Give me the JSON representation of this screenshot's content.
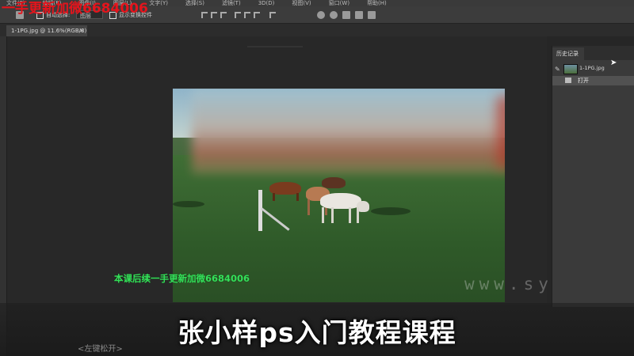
{
  "menubar": {
    "items": [
      "文件(F)",
      "编辑(E)",
      "图像(I)",
      "图层(L)",
      "文字(Y)",
      "选择(S)",
      "滤镜(T)",
      "3D(D)",
      "视图(V)",
      "窗口(W)",
      "帮助(H)"
    ]
  },
  "top_watermark": "一手更新加微6684006",
  "optionsbar": {
    "auto_select_label": "自动选择:",
    "layer_select_value": "图层",
    "show_transform_label": "显示变换控件"
  },
  "document_tab": {
    "title": "1-1PG.jpg @ 11.6%(RGB/8)",
    "close": "×"
  },
  "canvas": {
    "overlay_caption": "本课后续一手更新加微6684006",
    "site_watermark": "www.sy..."
  },
  "history_panel": {
    "tab_label": "历史记录",
    "snapshot_label": "1-1PG.jpg",
    "items": [
      {
        "label": "打开"
      }
    ]
  },
  "caption": {
    "title": "张小样ps入门教程课程",
    "hint": "<左键松开>"
  }
}
